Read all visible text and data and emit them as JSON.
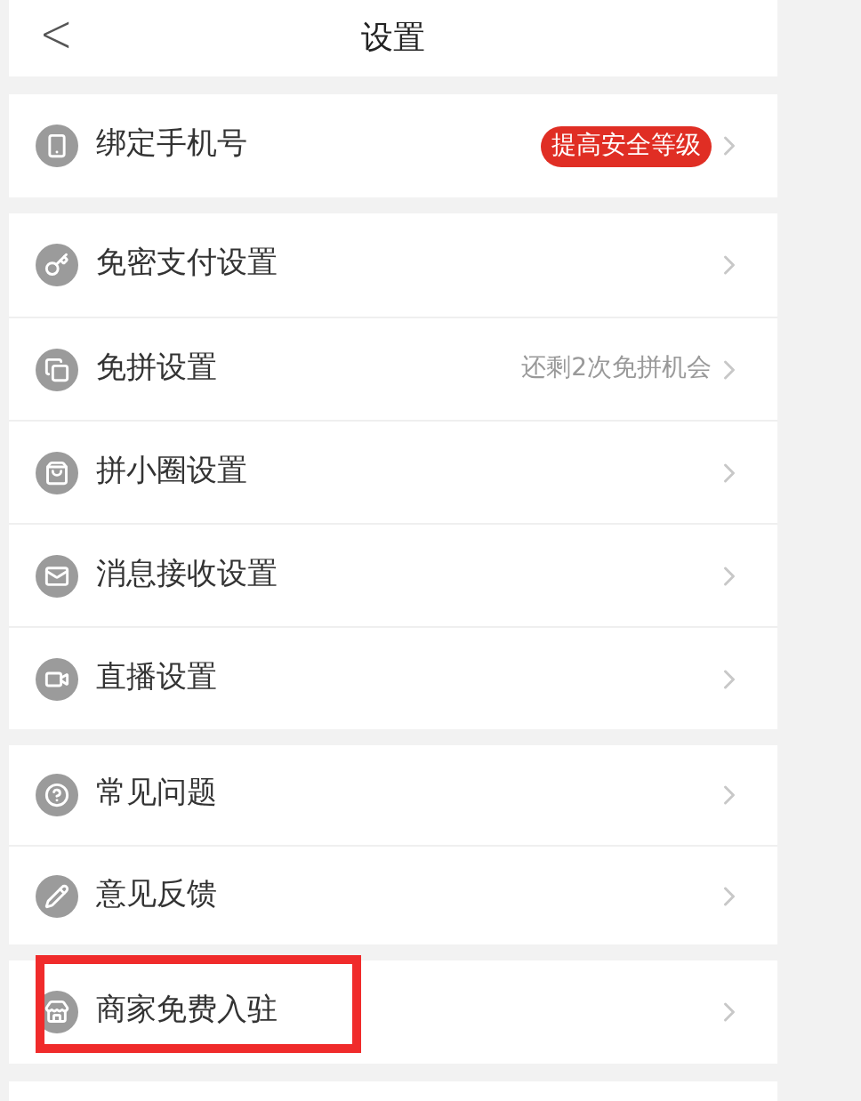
{
  "header": {
    "back": "<",
    "title": "设置"
  },
  "groups": [
    {
      "items": [
        {
          "label": "绑定手机号",
          "badge": "提高安全等级",
          "highlighted": false
        }
      ]
    },
    {
      "items": [
        {
          "label": "免密支付设置",
          "highlighted": false
        },
        {
          "label": "免拼设置",
          "note": "还剩2次免拼机会",
          "highlighted": false
        },
        {
          "label": "拼小圈设置",
          "highlighted": false
        },
        {
          "label": "消息接收设置",
          "highlighted": false
        },
        {
          "label": "直播设置",
          "highlighted": false
        }
      ]
    },
    {
      "items": [
        {
          "label": "常见问题",
          "highlighted": false
        },
        {
          "label": "意见反馈",
          "highlighted": false
        }
      ]
    },
    {
      "items": [
        {
          "label": "商家免费入驻",
          "highlighted": true
        }
      ]
    }
  ]
}
